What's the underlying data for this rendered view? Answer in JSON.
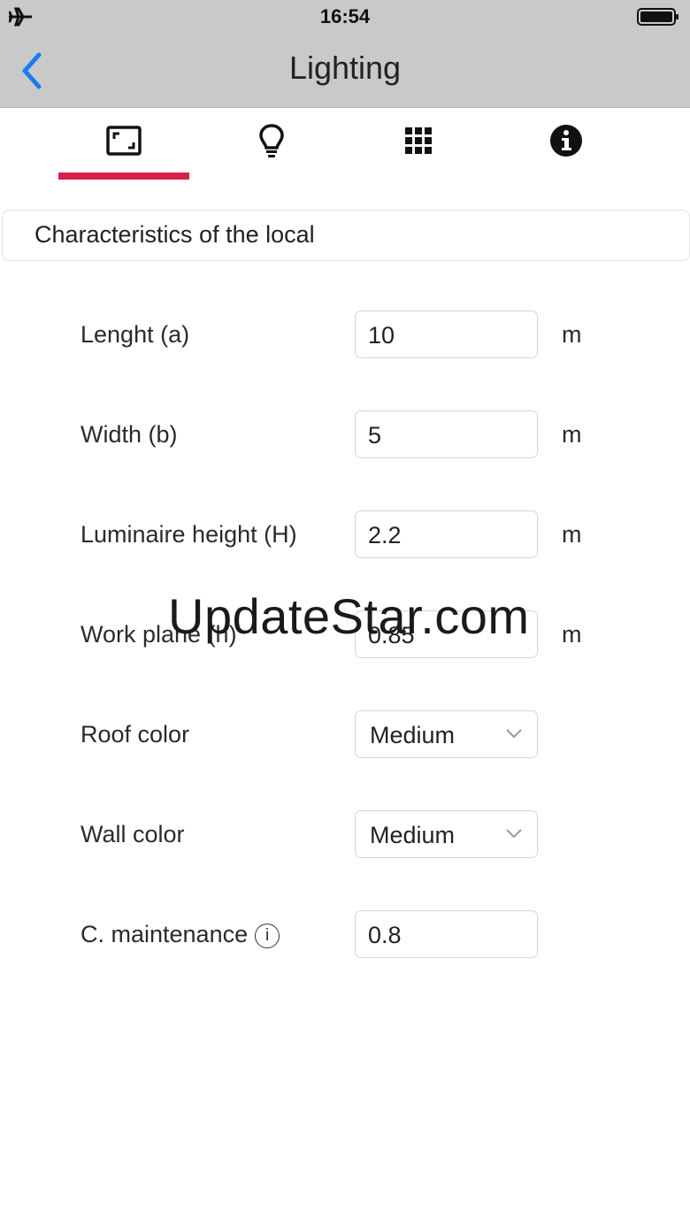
{
  "status": {
    "time": "16:54"
  },
  "nav": {
    "title": "Lighting"
  },
  "tabs": [
    {
      "icon": "room-dimensions-icon",
      "active": true
    },
    {
      "icon": "lightbulb-icon",
      "active": false
    },
    {
      "icon": "grid-icon",
      "active": false
    },
    {
      "icon": "info-icon",
      "active": false
    }
  ],
  "section": {
    "title": "Characteristics of the local"
  },
  "form": {
    "length": {
      "label": "Lenght (a)",
      "value": "10",
      "unit": "m"
    },
    "width": {
      "label": "Width (b)",
      "value": "5",
      "unit": "m"
    },
    "luminaire_height": {
      "label": "Luminaire height (H)",
      "value": "2.2",
      "unit": "m"
    },
    "work_plane": {
      "label": "Work plane (h)",
      "value": "0.85",
      "unit": "m"
    },
    "roof_color": {
      "label": "Roof color",
      "value": "Medium"
    },
    "wall_color": {
      "label": "Wall color",
      "value": "Medium"
    },
    "maintenance": {
      "label": "C. maintenance",
      "info_glyph": "i",
      "value": "0.8"
    }
  },
  "watermark": "UpdateStar.com",
  "colors": {
    "accent": "#d81f4a",
    "back": "#1a7cf0",
    "topbar": "#c9c9c9"
  }
}
